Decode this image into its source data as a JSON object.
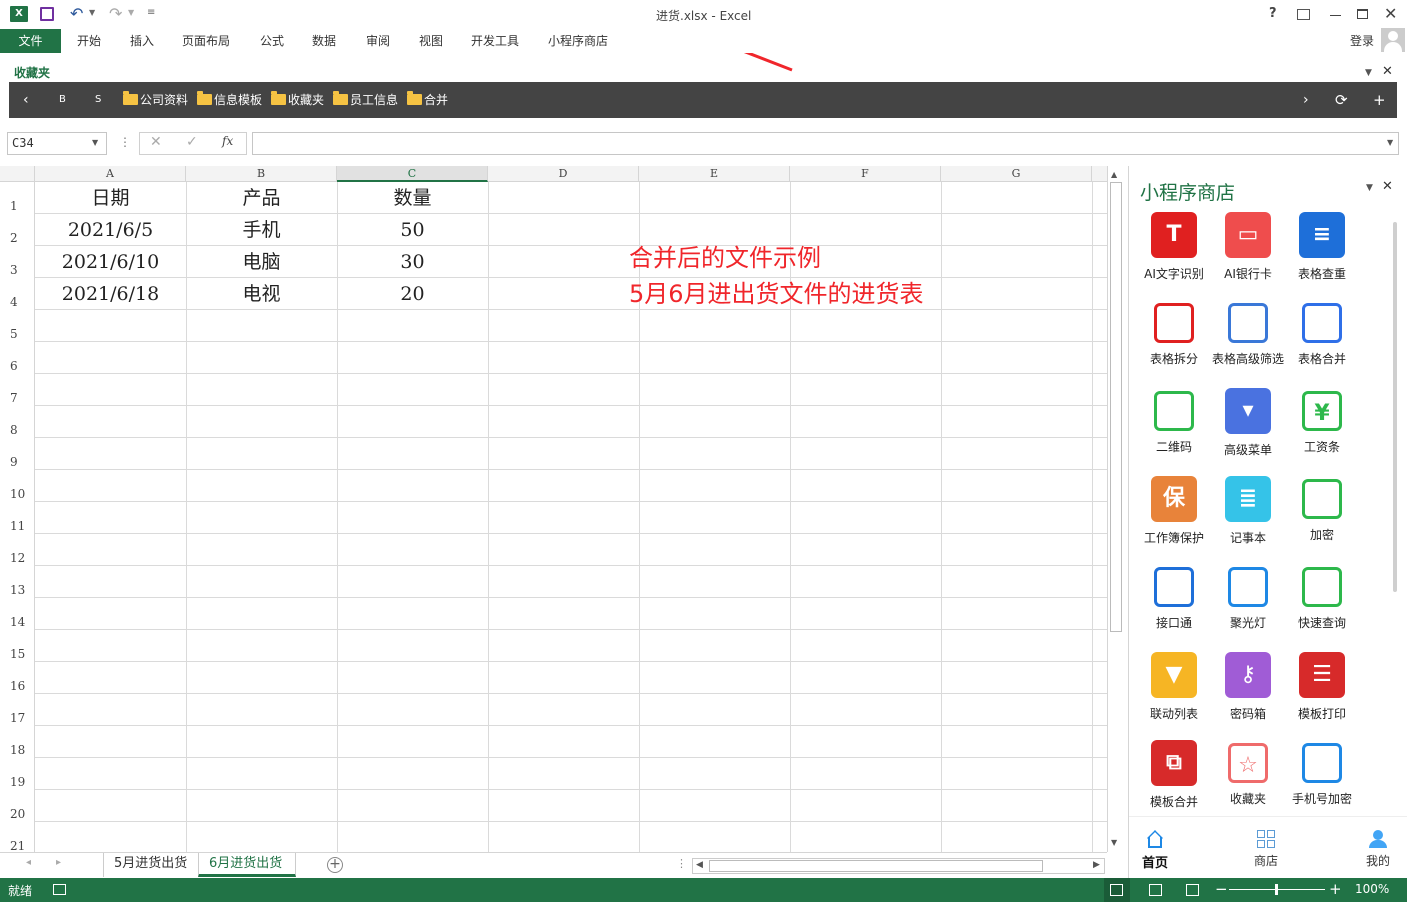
{
  "window": {
    "title": "进货.xlsx - Excel",
    "login": "登录"
  },
  "ribbon": {
    "file": "文件",
    "tabs": [
      "开始",
      "插入",
      "页面布局",
      "公式",
      "数据",
      "审阅",
      "视图",
      "开发工具",
      "小程序商店"
    ]
  },
  "favorites": {
    "label": "收藏夹",
    "nav_b": "B",
    "nav_s": "S",
    "folders": [
      "公司资料",
      "信息模板",
      "收藏夹",
      "员工信息",
      "合并"
    ]
  },
  "formula_bar": {
    "name_box": "C34",
    "fx": "fx",
    "value": ""
  },
  "sheet": {
    "columns": [
      "A",
      "B",
      "C",
      "D",
      "E",
      "F",
      "G"
    ],
    "rows": [
      "1",
      "2",
      "3",
      "4",
      "5",
      "6",
      "7",
      "8",
      "9",
      "10",
      "11",
      "12",
      "13",
      "14",
      "15",
      "16",
      "17",
      "18",
      "19",
      "20",
      "21"
    ],
    "cells": [
      [
        "日期",
        "产品",
        "数量"
      ],
      [
        "2021/6/5",
        "手机",
        "50"
      ],
      [
        "2021/6/10",
        "电脑",
        "30"
      ],
      [
        "2021/6/18",
        "电视",
        "20"
      ]
    ],
    "annotation_line1": "合并后的文件示例",
    "annotation_line2": "5月6月进出货文件的进货表"
  },
  "sheet_tabs": [
    "5月进货出货",
    "6月进货出货"
  ],
  "active_tab": "6月进货出货",
  "status": {
    "ready": "就绪",
    "zoom": "100%"
  },
  "panel": {
    "title": "小程序商店",
    "apps": [
      "AI文字识别",
      "AI银行卡",
      "表格查重",
      "表格拆分",
      "表格高级筛选",
      "表格合并",
      "二维码",
      "高级菜单",
      "工资条",
      "工作簿保护",
      "记事本",
      "加密",
      "接口通",
      "聚光灯",
      "快速查询",
      "联动列表",
      "密码箱",
      "模板打印",
      "模板合并",
      "收藏夹",
      "手机号加密"
    ],
    "nav": [
      "首页",
      "商店",
      "我的"
    ]
  },
  "colors": {
    "excel_green": "#217346",
    "annotation_red": "#f0262b"
  }
}
